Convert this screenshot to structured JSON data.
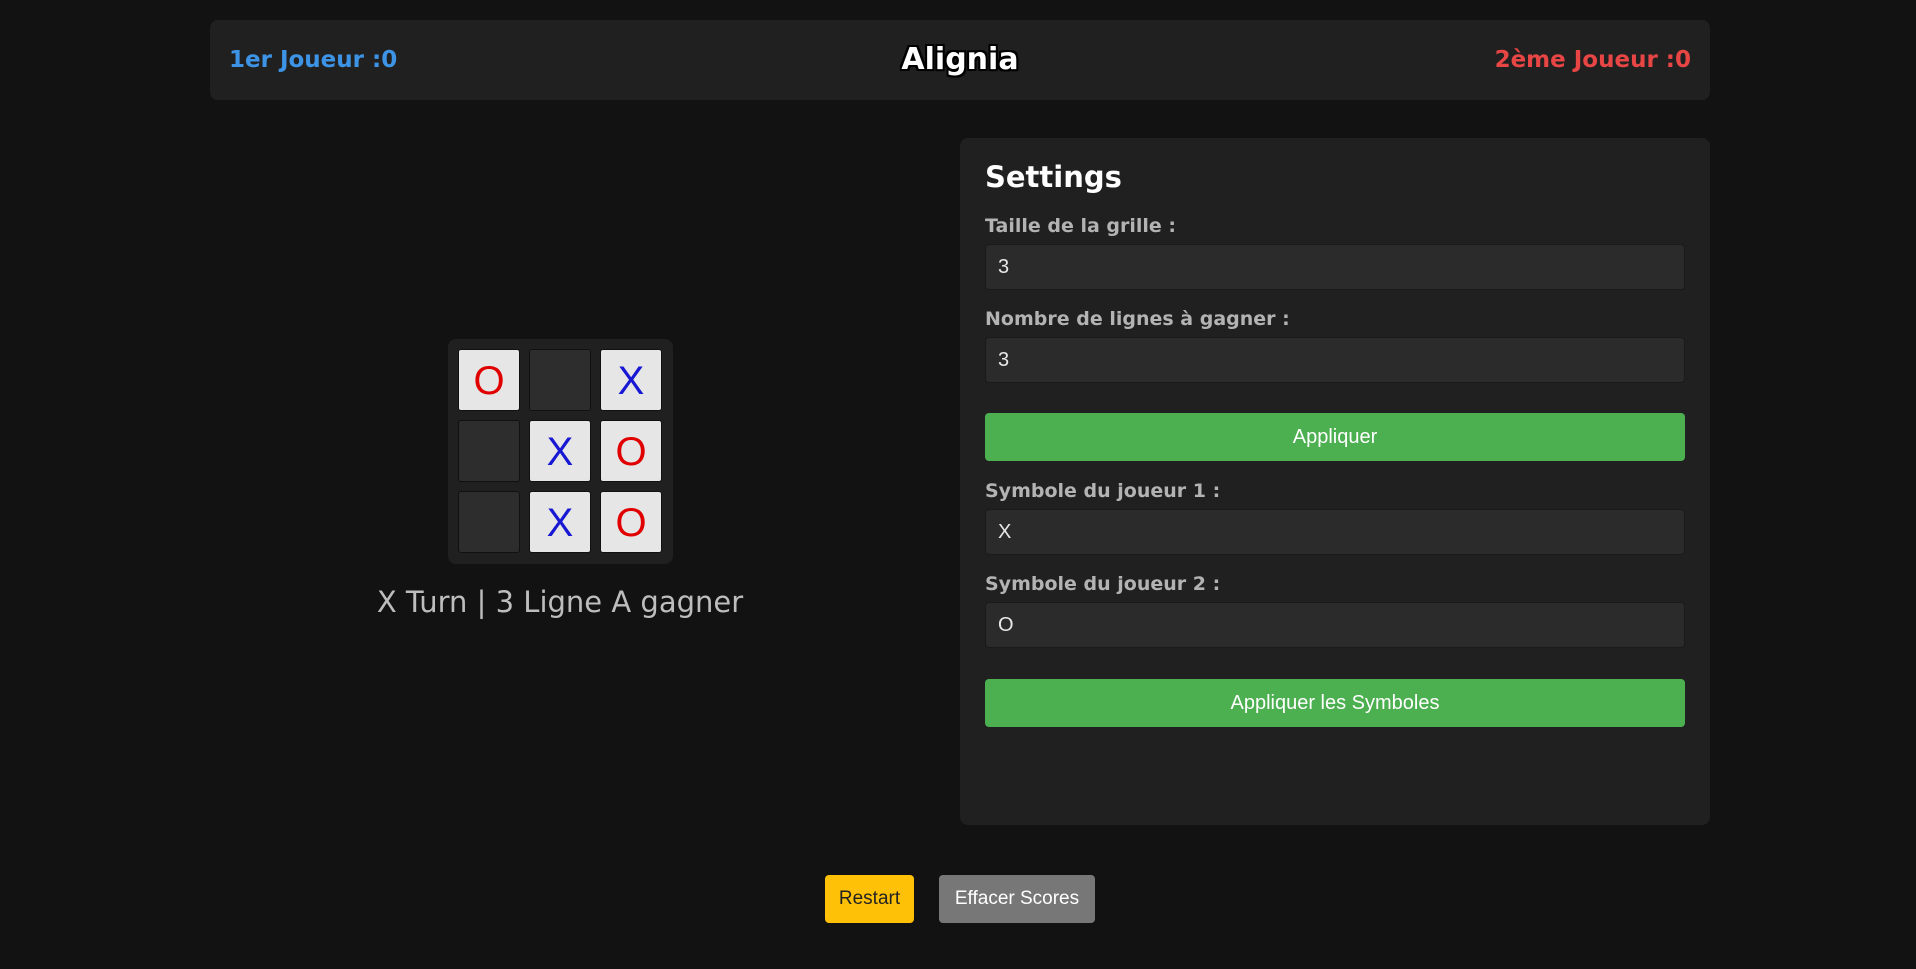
{
  "header": {
    "player1_score": "1er Joueur :0",
    "title": "Alignia",
    "player2_score": "2ème Joueur :0"
  },
  "board": {
    "cells": [
      "O",
      "",
      "X",
      "",
      "X",
      "O",
      "",
      "X",
      "O"
    ]
  },
  "status": "X Turn | 3 Ligne A gagner",
  "settings": {
    "title": "Settings",
    "grid_size_label": "Taille de la grille :",
    "grid_size_value": "3",
    "lines_to_win_label": "Nombre de lignes à gagner :",
    "lines_to_win_value": "3",
    "apply_label": "Appliquer",
    "player1_symbol_label": "Symbole du joueur 1 :",
    "player1_symbol_value": "X",
    "player2_symbol_label": "Symbole du joueur 2 :",
    "player2_symbol_value": "O",
    "apply_symbols_label": "Appliquer les Symboles"
  },
  "controls": {
    "restart_label": "Restart",
    "clear_scores_label": "Effacer Scores"
  },
  "colors": {
    "player1": "#3d94e6",
    "player2": "#e84545",
    "apply": "#4caf50",
    "restart": "#ffc107",
    "clear": "#777777"
  }
}
